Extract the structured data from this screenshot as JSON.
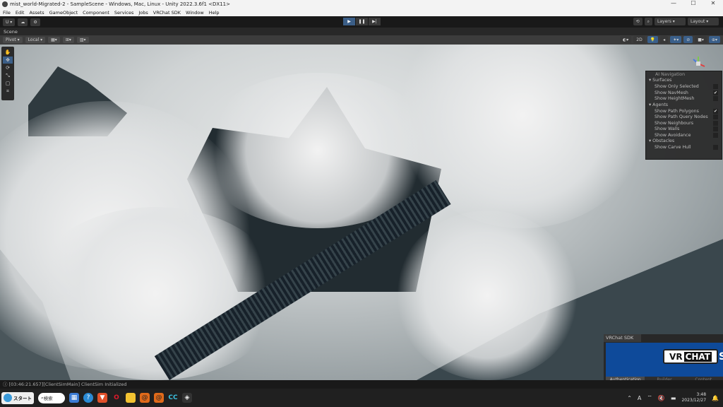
{
  "window": {
    "title": "mist_world-Migrated-2 - SampleScene - Windows, Mac, Linux - Unity 2022.3.6f1 <DX11>",
    "controls": [
      "—",
      "☐",
      "✕"
    ]
  },
  "menu": [
    "File",
    "Edit",
    "Assets",
    "GameObject",
    "Component",
    "Services",
    "Jobs",
    "VRChat SDK",
    "Window",
    "Help"
  ],
  "toolbar": {
    "account": "U ▾",
    "play": "▶",
    "pause": "❚❚",
    "step": "▶|",
    "layers": "Layers ▾",
    "layout": "Layout ▾"
  },
  "scene": {
    "tab_label": "Scene",
    "pivot": "Pivot ▾",
    "local": "Local ▾",
    "mode_2d": "2D"
  },
  "ai_navigation": {
    "title": "AI Navigation",
    "sections": [
      {
        "label": "Surfaces",
        "items": [
          {
            "label": "Show Only Selected",
            "checked": false
          },
          {
            "label": "Show NavMesh",
            "checked": true
          },
          {
            "label": "Show HeightMesh",
            "checked": false
          }
        ]
      },
      {
        "label": "Agents",
        "items": [
          {
            "label": "Show Path Polygons",
            "checked": true
          },
          {
            "label": "Show Path Query Nodes",
            "checked": false
          },
          {
            "label": "Show Neighbours",
            "checked": false
          },
          {
            "label": "Show Walls",
            "checked": false
          },
          {
            "label": "Show Avoidance",
            "checked": false
          }
        ]
      },
      {
        "label": "Obstacles",
        "items": [
          {
            "label": "Show Carve Hull",
            "checked": false
          }
        ]
      }
    ]
  },
  "console": {
    "message": "[03:46:21.657][ClientSimMain] ClientSim Initialized"
  },
  "vrchat_sdk": {
    "tab": "VRChat SDK",
    "logo_vr": "VR",
    "logo_chat": "CHAT",
    "logo_s": "S",
    "tabs": [
      "Authentication",
      "Builder",
      "Content"
    ]
  },
  "taskbar": {
    "start": "スタート",
    "search": "検索",
    "time": "3:48",
    "date": "2023/12/27",
    "ime": "A"
  }
}
